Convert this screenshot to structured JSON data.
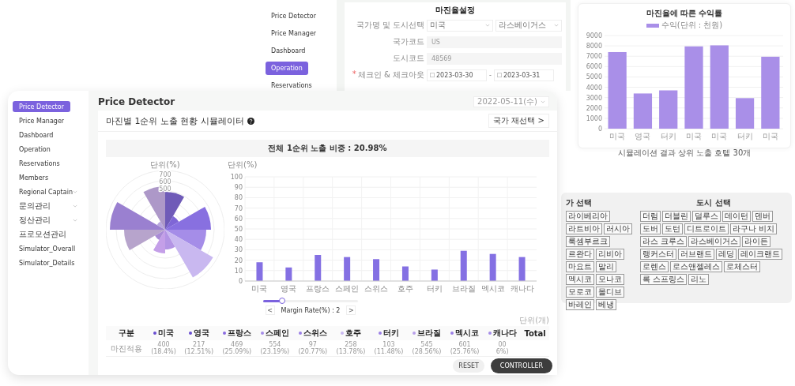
{
  "back_window": {
    "sidebar": {
      "items": [
        {
          "label": "Price Detector",
          "selected": false
        },
        {
          "label": "Price Manager",
          "selected": false
        },
        {
          "label": "Dashboard",
          "selected": false
        },
        {
          "label": "Operation",
          "selected": true
        },
        {
          "label": "Reservations",
          "selected": false
        }
      ]
    },
    "form": {
      "title": "마진율설정",
      "rows": [
        {
          "kind": "selects",
          "label": "국가명 및 도시선택",
          "values": [
            "미국",
            "라스베이거스"
          ]
        },
        {
          "kind": "readonly",
          "label": "국가코드",
          "value": "US"
        },
        {
          "kind": "readonly",
          "label": "도시코드",
          "value": "48569"
        },
        {
          "kind": "dates",
          "required_mark": "*",
          "label": "체크인 & 체크아웃",
          "values": [
            "2023-03-30",
            "2023-03-31"
          ],
          "separator": "-"
        }
      ]
    }
  },
  "profit_chart": {
    "chart_data": {
      "type": "bar",
      "title": "마진율에 따른 수익률",
      "xlabel": "시뮬레이션 결과 상위 노출 호텔 30개",
      "categories": [
        "미국",
        "영국",
        "터키",
        "미국",
        "미국",
        "터키",
        "미국"
      ],
      "series": [
        {
          "name": "수익(단위 : 천원)",
          "color": "#a98fe8",
          "values": [
            7400,
            3400,
            3700,
            7950,
            8050,
            2950,
            6950
          ]
        }
      ],
      "ylim": [
        0,
        9000
      ],
      "yticks": [
        0,
        1000,
        2000,
        3000,
        4000,
        5000,
        6000,
        7000,
        8000,
        9000
      ],
      "grid": true
    }
  },
  "selection_panel": {
    "country_title": "가 선택",
    "city_title": "도시 선택",
    "country_chips": [
      "라이베리아",
      "라트비아",
      "러시아",
      "룩셈부르크",
      "르완다",
      "리비아",
      "마요트",
      "말리",
      "멕시코",
      "모나코",
      "모로코",
      "몰디브",
      "바레인",
      "베냉"
    ],
    "city_chips": [
      "더럼",
      "더블린",
      "덜루스",
      "데이턴",
      "덴버",
      "도버",
      "도턴",
      "디트로이트",
      "라구나 비치",
      "라스 크루스",
      "라스베이거스",
      "라이든",
      "랭커스터",
      "러브랜드",
      "레딩",
      "레이크랜드",
      "로렌스",
      "로스앤젤레스",
      "로체스터",
      "록 스프링스",
      "리노"
    ]
  },
  "front_window": {
    "sidebar": {
      "items": [
        {
          "label": "Price Detector",
          "selected": true,
          "expandable": false
        },
        {
          "label": "Price Manager",
          "selected": false,
          "expandable": false
        },
        {
          "label": "Dashboard",
          "selected": false,
          "expandable": false
        },
        {
          "label": "Operation",
          "selected": false,
          "expandable": false
        },
        {
          "label": "Reservations",
          "selected": false,
          "expandable": false
        },
        {
          "label": "Members",
          "selected": false,
          "expandable": false
        },
        {
          "label": "Regional Captain",
          "selected": false,
          "expandable": true
        },
        {
          "label": "문의관리",
          "selected": false,
          "expandable": true
        },
        {
          "label": "정산관리",
          "selected": false,
          "expandable": true
        },
        {
          "label": "프로모션관리",
          "selected": false,
          "expandable": false
        },
        {
          "label": "Simulator_Overall",
          "selected": false,
          "expandable": false
        },
        {
          "label": "Simulator_Details",
          "selected": false,
          "expandable": false
        }
      ]
    },
    "page_title": "Price Detector",
    "date_select": "2022-05-11(수)",
    "card": {
      "title": "마진별 1순위 노출 현황 시뮬레이터",
      "reselect_button": "국가 재선택 >",
      "summary": "전체 1순위 노출 비중 : 20.98%",
      "polar_chart": {
        "unit": "단위(%)",
        "ticks": [
          "700",
          "600",
          "500"
        ]
      },
      "bar_chart": {
        "chart_data": {
          "type": "bar",
          "ylabel": "단위(%)",
          "categories": [
            "미국",
            "영국",
            "프랑스",
            "스페인",
            "스위스",
            "호주",
            "터키",
            "브라질",
            "멕시코",
            "캐나다"
          ],
          "values": [
            18,
            13,
            25,
            23,
            21,
            14,
            11,
            29,
            26,
            23
          ],
          "color": "#8470e3",
          "ylim": [
            0,
            100
          ],
          "yticks": [
            0,
            10,
            20,
            30,
            40,
            50,
            60,
            70,
            80,
            90,
            100
          ],
          "grid": true
        }
      },
      "margin": {
        "level": 0.2,
        "label": "Margin Rate(%) : 2",
        "prev": "<",
        "next": ">"
      },
      "table": {
        "unit": "단위(개)",
        "columns": [
          {
            "label": "구분"
          },
          {
            "label": "미국",
            "color": "#6a4fd0"
          },
          {
            "label": "영국",
            "color": "#6a4fd0"
          },
          {
            "label": "프랑스",
            "color": "#8a6be0"
          },
          {
            "label": "스페인",
            "color": "#a58de8"
          },
          {
            "label": "스위스",
            "color": "#9b7fe6"
          },
          {
            "label": "호주",
            "color": "#c8b8f0"
          },
          {
            "label": "터키",
            "color": "#9b7fe6"
          },
          {
            "label": "브라질",
            "color": "#b9a0ea"
          },
          {
            "label": "멕시코",
            "color": "#9b7fe6"
          },
          {
            "label": "캐나다",
            "color": "#a58de8"
          },
          {
            "label": "Total"
          }
        ],
        "rows": [
          {
            "cells": [
              {
                "value": "마진적용"
              },
              {
                "value": "400",
                "percent": "(18.4%)"
              },
              {
                "value": "217",
                "percent": "(12.51%)"
              },
              {
                "value": "469",
                "percent": "(25.09%)"
              },
              {
                "value": "554",
                "percent": "(23.19%)"
              },
              {
                "value": "97",
                "percent": "(20.77%)"
              },
              {
                "value": "258",
                "percent": "(13.78%)"
              },
              {
                "value": "103",
                "percent": "(11.48%)"
              },
              {
                "value": "545",
                "percent": "(28.56%)"
              },
              {
                "value": "601",
                "percent": "(25.76%)"
              },
              {
                "value": "00",
                "percent": "6%)"
              }
            ]
          }
        ]
      }
    },
    "reset_button": "RESET",
    "controller_button": "CONTROLLER"
  }
}
